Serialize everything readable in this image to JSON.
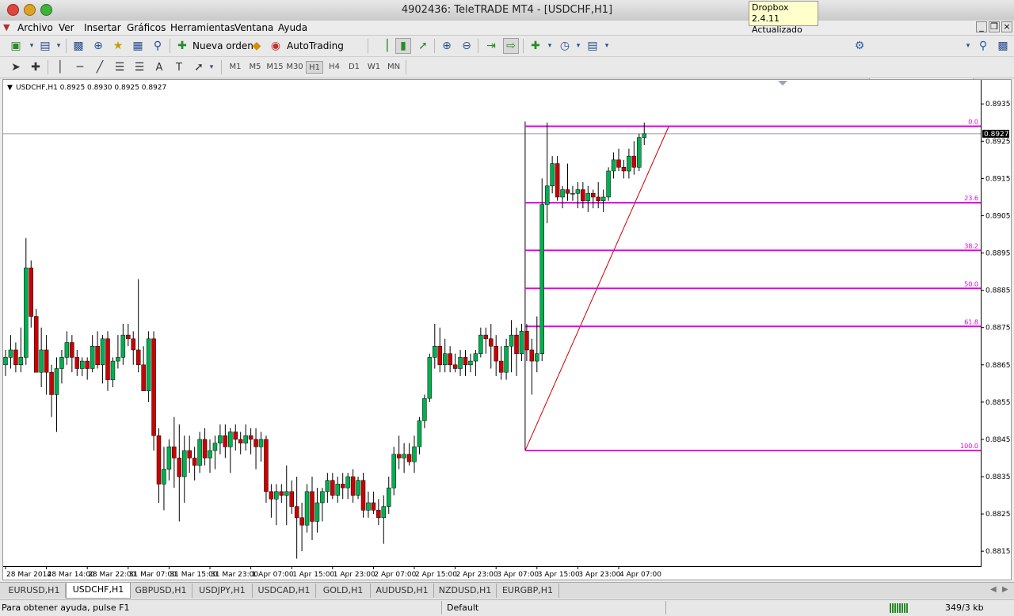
{
  "window": {
    "title": "4902436: TeleTRADE MT4 - [USDCHF,H1]"
  },
  "tooltip": {
    "line1": "Dropbox 2.4.11",
    "line2": "Actualizado"
  },
  "menu": [
    "Archivo",
    "Ver",
    "Insertar",
    "Gráficos",
    "Herramientas",
    "Ventana",
    "Ayuda"
  ],
  "toolbar": {
    "new_order": "Nueva orden",
    "autotrading": "AutoTrading"
  },
  "timeframes": [
    "M1",
    "M5",
    "M15",
    "M30",
    "H1",
    "H4",
    "D1",
    "W1",
    "MN"
  ],
  "active_timeframe": "H1",
  "chart": {
    "header": "USDCHF,H1  0.8925 0.8930 0.8925 0.8927",
    "current_price": "0.8927",
    "colors": {
      "bull": "#00b050",
      "bear": "#cc0000",
      "fib": "#e000e0",
      "trend": "#cc0000",
      "grid_line": "#9a9a9a"
    }
  },
  "chart_data": {
    "type": "candlestick",
    "symbol": "USDCHF",
    "timeframe": "H1",
    "ylim": [
      0.8811,
      0.8941
    ],
    "y_ticks": [
      "0.8935",
      "0.8925",
      "0.8915",
      "0.8905",
      "0.8895",
      "0.8885",
      "0.8875",
      "0.8865",
      "0.8855",
      "0.8845",
      "0.8835",
      "0.8825",
      "0.8815"
    ],
    "x_ticks": [
      "28 Mar 2014",
      "28 Mar 14:00",
      "28 Mar 22:00",
      "31 Mar 07:00",
      "31 Mar 15:00",
      "31 Mar 23:00",
      "1 Apr 07:00",
      "1 Apr 15:00",
      "1 Apr 23:00",
      "2 Apr 07:00",
      "2 Apr 15:00",
      "2 Apr 23:00",
      "3 Apr 07:00",
      "3 Apr 15:00",
      "3 Apr 23:00",
      "4 Apr 07:00"
    ],
    "fibonacci": {
      "start_price": 0.8842,
      "end_price": 0.8929,
      "levels": [
        {
          "label": "0.0",
          "price": 0.8929
        },
        {
          "label": "23.6",
          "price": 0.89085
        },
        {
          "label": "38.2",
          "price": 0.88957
        },
        {
          "label": "50.0",
          "price": 0.88855
        },
        {
          "label": "61.8",
          "price": 0.88753
        },
        {
          "label": "100.0",
          "price": 0.8842
        }
      ]
    },
    "candles": [
      [
        0.8865,
        0.8869,
        0.8862,
        0.8867
      ],
      [
        0.8867,
        0.8873,
        0.8864,
        0.8869
      ],
      [
        0.8869,
        0.8871,
        0.8863,
        0.8865
      ],
      [
        0.8865,
        0.8875,
        0.8863,
        0.8867
      ],
      [
        0.8867,
        0.8899,
        0.8865,
        0.8891
      ],
      [
        0.8891,
        0.8893,
        0.8875,
        0.8878
      ],
      [
        0.8878,
        0.888,
        0.8863,
        0.8863
      ],
      [
        0.8863,
        0.8875,
        0.8859,
        0.8869
      ],
      [
        0.8869,
        0.8873,
        0.8857,
        0.8863
      ],
      [
        0.8863,
        0.8865,
        0.8851,
        0.8857
      ],
      [
        0.8857,
        0.8867,
        0.8847,
        0.8864
      ],
      [
        0.8864,
        0.8869,
        0.886,
        0.8867
      ],
      [
        0.8867,
        0.8874,
        0.8865,
        0.8871
      ],
      [
        0.8871,
        0.8873,
        0.8863,
        0.8867
      ],
      [
        0.8867,
        0.8869,
        0.8862,
        0.8864
      ],
      [
        0.8864,
        0.8867,
        0.8862,
        0.8866
      ],
      [
        0.8866,
        0.8867,
        0.8861,
        0.8864
      ],
      [
        0.8864,
        0.8873,
        0.8863,
        0.887
      ],
      [
        0.887,
        0.8874,
        0.8864,
        0.8865
      ],
      [
        0.8865,
        0.8873,
        0.886,
        0.8872
      ],
      [
        0.8872,
        0.8874,
        0.8858,
        0.8861
      ],
      [
        0.8861,
        0.8867,
        0.8859,
        0.8866
      ],
      [
        0.8866,
        0.8873,
        0.8864,
        0.8867
      ],
      [
        0.8867,
        0.8876,
        0.8865,
        0.8873
      ],
      [
        0.8873,
        0.8876,
        0.887,
        0.8872
      ],
      [
        0.8872,
        0.8874,
        0.8865,
        0.8869
      ],
      [
        0.8869,
        0.8888,
        0.8863,
        0.8865
      ],
      [
        0.8865,
        0.887,
        0.8858,
        0.8858
      ],
      [
        0.8858,
        0.8874,
        0.8855,
        0.8872
      ],
      [
        0.8872,
        0.8874,
        0.8842,
        0.8846
      ],
      [
        0.8846,
        0.8848,
        0.8828,
        0.8833
      ],
      [
        0.8833,
        0.8843,
        0.8826,
        0.8837
      ],
      [
        0.8837,
        0.8845,
        0.8834,
        0.8843
      ],
      [
        0.8843,
        0.8851,
        0.8832,
        0.884
      ],
      [
        0.884,
        0.8849,
        0.8823,
        0.8835
      ],
      [
        0.8835,
        0.8846,
        0.8828,
        0.8842
      ],
      [
        0.8842,
        0.8846,
        0.8836,
        0.884
      ],
      [
        0.884,
        0.8843,
        0.8834,
        0.8838
      ],
      [
        0.8838,
        0.8847,
        0.8836,
        0.8845
      ],
      [
        0.8845,
        0.8848,
        0.8838,
        0.884
      ],
      [
        0.884,
        0.8845,
        0.8836,
        0.8842
      ],
      [
        0.8842,
        0.8846,
        0.8837,
        0.8844
      ],
      [
        0.8844,
        0.8849,
        0.8841,
        0.8846
      ],
      [
        0.8846,
        0.8849,
        0.884,
        0.8843
      ],
      [
        0.8843,
        0.8848,
        0.8836,
        0.8847
      ],
      [
        0.8847,
        0.8849,
        0.8842,
        0.8845
      ],
      [
        0.8845,
        0.8847,
        0.8841,
        0.8844
      ],
      [
        0.8844,
        0.8849,
        0.8842,
        0.8846
      ],
      [
        0.8846,
        0.8848,
        0.8841,
        0.8845
      ],
      [
        0.8845,
        0.8848,
        0.8837,
        0.8843
      ],
      [
        0.8843,
        0.8847,
        0.8839,
        0.8845
      ],
      [
        0.8845,
        0.8846,
        0.8828,
        0.8831
      ],
      [
        0.8831,
        0.8833,
        0.8824,
        0.8829
      ],
      [
        0.8829,
        0.8833,
        0.8822,
        0.8831
      ],
      [
        0.8831,
        0.8833,
        0.8828,
        0.883
      ],
      [
        0.883,
        0.8838,
        0.8822,
        0.8831
      ],
      [
        0.8831,
        0.8834,
        0.8825,
        0.8827
      ],
      [
        0.8827,
        0.8835,
        0.8813,
        0.8824
      ],
      [
        0.8824,
        0.8828,
        0.8815,
        0.8822
      ],
      [
        0.8822,
        0.8833,
        0.882,
        0.8831
      ],
      [
        0.8831,
        0.8835,
        0.8818,
        0.8823
      ],
      [
        0.8823,
        0.8832,
        0.882,
        0.8828
      ],
      [
        0.8828,
        0.8832,
        0.8823,
        0.8831
      ],
      [
        0.8831,
        0.8836,
        0.8828,
        0.8834
      ],
      [
        0.8834,
        0.8836,
        0.8829,
        0.883
      ],
      [
        0.883,
        0.8835,
        0.8828,
        0.8833
      ],
      [
        0.8833,
        0.8836,
        0.8829,
        0.8832
      ],
      [
        0.8832,
        0.8836,
        0.8829,
        0.8835
      ],
      [
        0.8835,
        0.8837,
        0.8828,
        0.883
      ],
      [
        0.883,
        0.8835,
        0.8829,
        0.8834
      ],
      [
        0.8834,
        0.8836,
        0.8824,
        0.8826
      ],
      [
        0.8826,
        0.8831,
        0.8824,
        0.8828
      ],
      [
        0.8828,
        0.8831,
        0.8825,
        0.8826
      ],
      [
        0.8826,
        0.8829,
        0.8822,
        0.8824
      ],
      [
        0.8824,
        0.883,
        0.8817,
        0.8827
      ],
      [
        0.8827,
        0.8835,
        0.8825,
        0.8832
      ],
      [
        0.8832,
        0.8843,
        0.883,
        0.8841
      ],
      [
        0.8841,
        0.8846,
        0.8837,
        0.884
      ],
      [
        0.884,
        0.8844,
        0.8836,
        0.8841
      ],
      [
        0.8841,
        0.8844,
        0.8838,
        0.8839
      ],
      [
        0.8839,
        0.8846,
        0.8836,
        0.8843
      ],
      [
        0.8843,
        0.8851,
        0.8841,
        0.885
      ],
      [
        0.885,
        0.8857,
        0.8848,
        0.8856
      ],
      [
        0.8856,
        0.8868,
        0.8855,
        0.8867
      ],
      [
        0.8867,
        0.8876,
        0.8864,
        0.887
      ],
      [
        0.887,
        0.8875,
        0.8863,
        0.8865
      ],
      [
        0.8865,
        0.8872,
        0.8863,
        0.8868
      ],
      [
        0.8868,
        0.887,
        0.8863,
        0.8865
      ],
      [
        0.8865,
        0.8868,
        0.8863,
        0.8864
      ],
      [
        0.8864,
        0.8869,
        0.8862,
        0.8867
      ],
      [
        0.8867,
        0.8869,
        0.8862,
        0.8865
      ],
      [
        0.8865,
        0.8868,
        0.8863,
        0.8866
      ],
      [
        0.8866,
        0.8869,
        0.8862,
        0.8868
      ],
      [
        0.8868,
        0.8875,
        0.8867,
        0.8873
      ],
      [
        0.8873,
        0.8875,
        0.8868,
        0.8872
      ],
      [
        0.8872,
        0.8876,
        0.8864,
        0.887
      ],
      [
        0.887,
        0.8873,
        0.8862,
        0.8866
      ],
      [
        0.8866,
        0.887,
        0.8861,
        0.8863
      ],
      [
        0.8863,
        0.8872,
        0.8861,
        0.887
      ],
      [
        0.887,
        0.8877,
        0.8863,
        0.8873
      ],
      [
        0.8873,
        0.8875,
        0.8862,
        0.8868
      ],
      [
        0.8868,
        0.8876,
        0.8866,
        0.8874
      ],
      [
        0.8874,
        0.8876,
        0.8866,
        0.8869
      ],
      [
        0.8869,
        0.8872,
        0.8857,
        0.8866
      ],
      [
        0.8866,
        0.8878,
        0.8863,
        0.8868
      ],
      [
        0.8868,
        0.8915,
        0.8866,
        0.8908
      ],
      [
        0.8908,
        0.893,
        0.8903,
        0.8913
      ],
      [
        0.8913,
        0.8921,
        0.8911,
        0.8919
      ],
      [
        0.8919,
        0.8921,
        0.8909,
        0.891
      ],
      [
        0.891,
        0.8913,
        0.8907,
        0.8912
      ],
      [
        0.8912,
        0.8919,
        0.8909,
        0.8911
      ],
      [
        0.8911,
        0.8913,
        0.8909,
        0.8911
      ],
      [
        0.8911,
        0.8914,
        0.8907,
        0.8912
      ],
      [
        0.8912,
        0.8914,
        0.8907,
        0.8909
      ],
      [
        0.8909,
        0.8913,
        0.8906,
        0.8911
      ],
      [
        0.8911,
        0.8912,
        0.8907,
        0.891
      ],
      [
        0.891,
        0.8914,
        0.8907,
        0.8909
      ],
      [
        0.8909,
        0.8912,
        0.8906,
        0.891
      ],
      [
        0.891,
        0.8918,
        0.8909,
        0.8917
      ],
      [
        0.8917,
        0.8922,
        0.8915,
        0.892
      ],
      [
        0.892,
        0.8923,
        0.8917,
        0.8918
      ],
      [
        0.8918,
        0.892,
        0.8915,
        0.8917
      ],
      [
        0.8917,
        0.8923,
        0.8915,
        0.8921
      ],
      [
        0.8921,
        0.8925,
        0.8916,
        0.8918
      ],
      [
        0.8918,
        0.8927,
        0.8917,
        0.8926
      ],
      [
        0.8926,
        0.893,
        0.8924,
        0.8927
      ]
    ]
  },
  "tabs": [
    "EURUSD,H1",
    "USDCHF,H1",
    "GBPUSD,H1",
    "USDJPY,H1",
    "USDCAD,H1",
    "GOLD,H1",
    "AUDUSD,H1",
    "NZDUSD,H1",
    "EURGBP,H1"
  ],
  "active_tab": "USDCHF,H1",
  "status": {
    "help": "Para obtener ayuda, pulse F1",
    "profile": "Default",
    "traffic": "349/3 kb"
  }
}
